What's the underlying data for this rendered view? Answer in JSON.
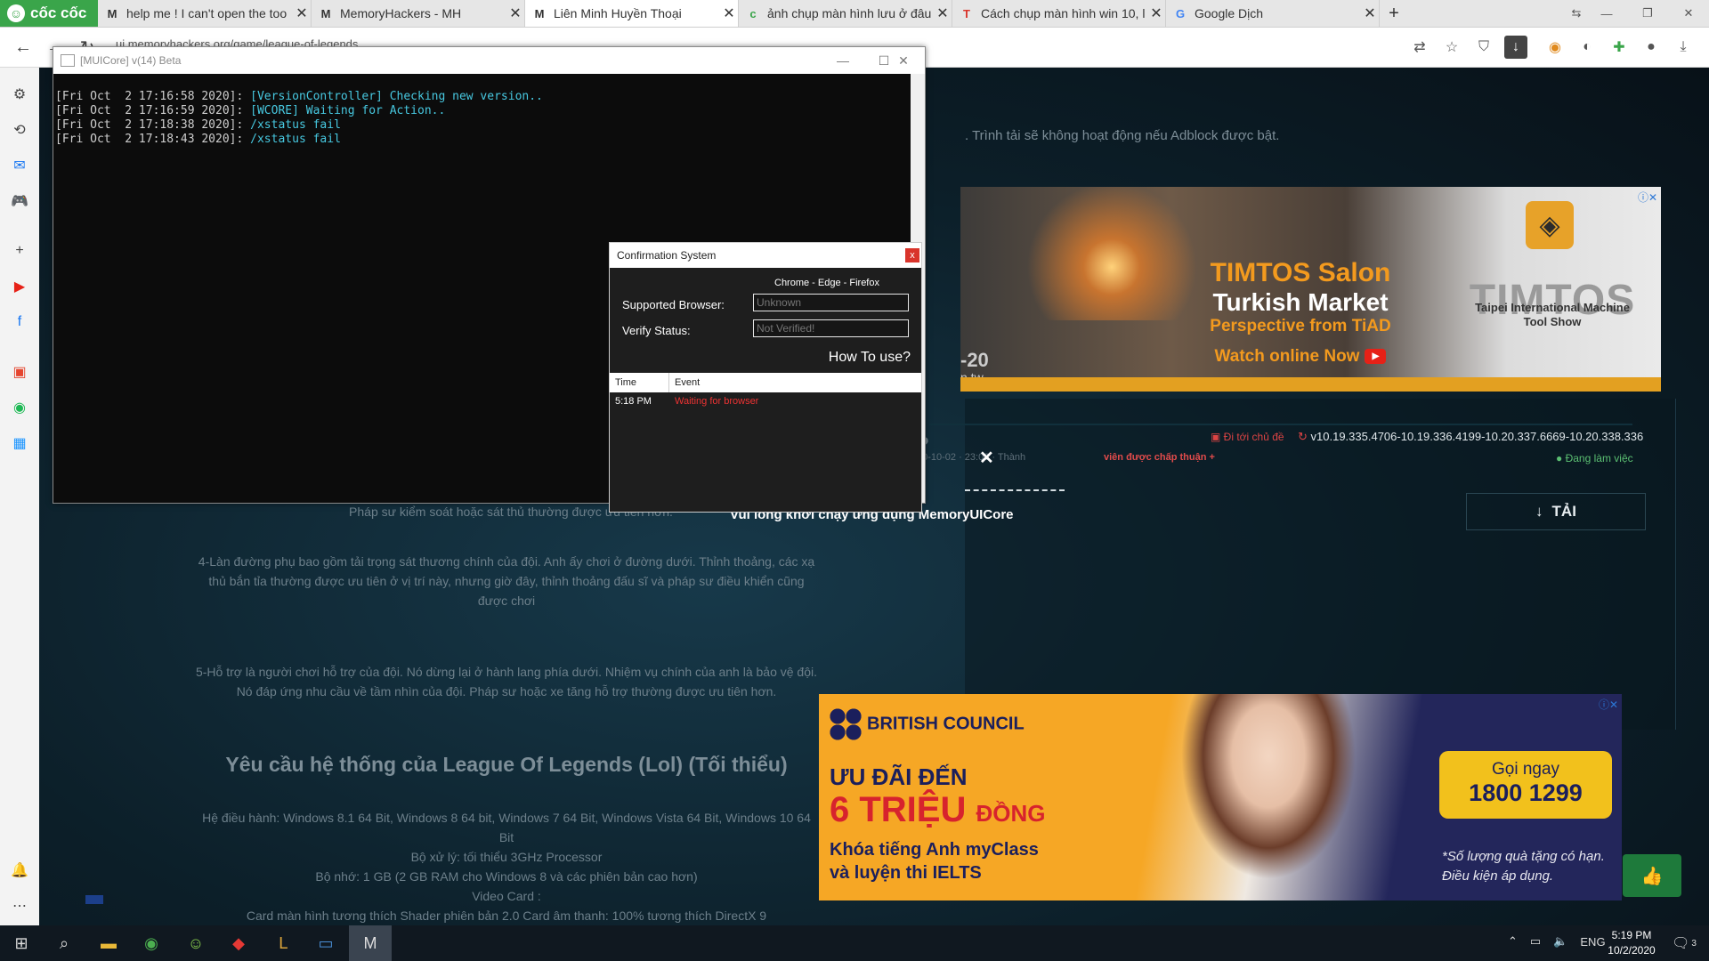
{
  "browser": {
    "brand": "cốc cốc",
    "tabs": [
      {
        "title": "help me ! I can't open the too",
        "favicon": "M",
        "active": false
      },
      {
        "title": "MemoryHackers - MH",
        "favicon": "M",
        "active": false
      },
      {
        "title": "Liên Minh Huyền Thoại",
        "favicon": "M",
        "active": true
      },
      {
        "title": "ảnh chụp màn hình lưu ở đâu",
        "favicon": "c",
        "active": false
      },
      {
        "title": "Cách chụp màn hình win 10, l",
        "favicon": "T",
        "active": false
      },
      {
        "title": "Google Dịch",
        "favicon": "G",
        "active": false
      }
    ],
    "url": "ui.memoryhackers.org/game/league-of-legends"
  },
  "page": {
    "adblock_notice": ". Trình tải sẽ không hoạt động nếu Adblock được bật.",
    "paragraph_0": "Pháp sư kiểm soát hoặc sát thủ thường được ưu tiên hơn.",
    "paragraph_1": "4-Làn đường phụ bao gồm tải trọng sát thương chính của đội. Anh ấy chơi ở đường dưới. Thỉnh thoảng, các xạ thủ bắn tỉa thường được ưu tiên ở vị trí này, nhưng giờ đây, thỉnh thoảng đấu sĩ và pháp sư điều khiển cũng được chơi",
    "paragraph_2": "5-Hỗ trợ là người chơi hỗ trợ của đội. Nó dừng lại ở hành lang phía dưới. Nhiệm vụ chính của anh là bảo vệ đội. Nó đáp ứng nhu cầu về tầm nhìn của đội. Pháp sư hoặc xe tăng hỗ trợ thường được ưu tiên hơn.",
    "heading": "Yêu cầu hệ thống của League Of Legends (Lol) (Tối thiểu)",
    "req_os": "Hệ điều hành: Windows 8.1 64 Bit, Windows 8 64 bit, Windows 7 64 Bit, Windows Vista 64 Bit, Windows 10 64 Bit",
    "req_cpu": "Bộ xử lý: tối thiểu 3GHz Processor",
    "req_ram": "Bộ nhớ: 1 GB (2 GB RAM cho Windows 8 và các phiên bản cao hơn)",
    "req_gpu_label": "Video Card :",
    "req_gpu": "Card màn hình tương thích Shader phiên bản 2.0 Card âm thanh: 100% tương thích DirectX 9"
  },
  "download": {
    "title_fragment": "P",
    "goto_topic": "Đi tới chủ đề",
    "version": "v10.19.335.4706-10.19.336.4199-10.20.337.6669-10.20.338.336",
    "meta": "20-10-02 · 23:03 · Thành",
    "meta_highlight": "viên được chấp thuận +",
    "status": "Đang làm việc",
    "button": "TẢI",
    "launch_message": "Vui lòng khởi chạy ứng dụng MemoryUICore"
  },
  "ad1": {
    "headline": "TIMTOS Salon",
    "line2": "Turkish Market",
    "line3": "Perspective from TiAD",
    "cta": "Watch online Now",
    "brand": "TIMTOS",
    "brand_sub": "Taipei International Machine Tool Show",
    "number_fragment": "-20",
    "domain_fragment": "n.tw"
  },
  "ad2": {
    "brand": "BRITISH COUNCIL",
    "line1": "ƯU ĐÃI ĐẾN",
    "line2_big": "6 TRIỆU",
    "line2_small": "ĐỒNG",
    "line3": "Khóa tiếng Anh myClass",
    "line4": "và luyện thi IELTS",
    "call_label": "Gọi ngay",
    "call_number": "1800 1299",
    "note": "*Số lượng quà tặng có hạn. Điều kiện áp dụng."
  },
  "console": {
    "title": "[MUICore] v(14) Beta",
    "lines": [
      {
        "prefix": "[Fri Oct  2 17:16:58 2020]: ",
        "msg": "[VersionController] Checking new version.."
      },
      {
        "prefix": "[Fri Oct  2 17:16:59 2020]: ",
        "msg": "[WCORE] Waiting for Action.."
      },
      {
        "prefix": "[Fri Oct  2 17:18:38 2020]: ",
        "msg": "/xstatus fail"
      },
      {
        "prefix": "[Fri Oct  2 17:18:43 2020]: ",
        "msg": "/xstatus fail"
      }
    ]
  },
  "confirm": {
    "title": "Confirmation System",
    "close": "x",
    "browsers": "Chrome - Edge - Firefox",
    "supported_label": "Supported Browser:",
    "supported_value": "Unknown",
    "verify_label": "Verify Status:",
    "verify_value": "Not Verified!",
    "how_to": "How To use?",
    "col_time": "Time",
    "col_event": "Event",
    "log_time": "5:18 PM",
    "log_event": "Waiting for browser"
  },
  "taskbar": {
    "lang": "ENG",
    "time": "5:19 PM",
    "date": "10/2/2020",
    "notif_count": "3"
  },
  "colors": {
    "accent_green": "#3aa54a",
    "error_red": "#e33333",
    "console_cyan": "#47c8e0"
  }
}
